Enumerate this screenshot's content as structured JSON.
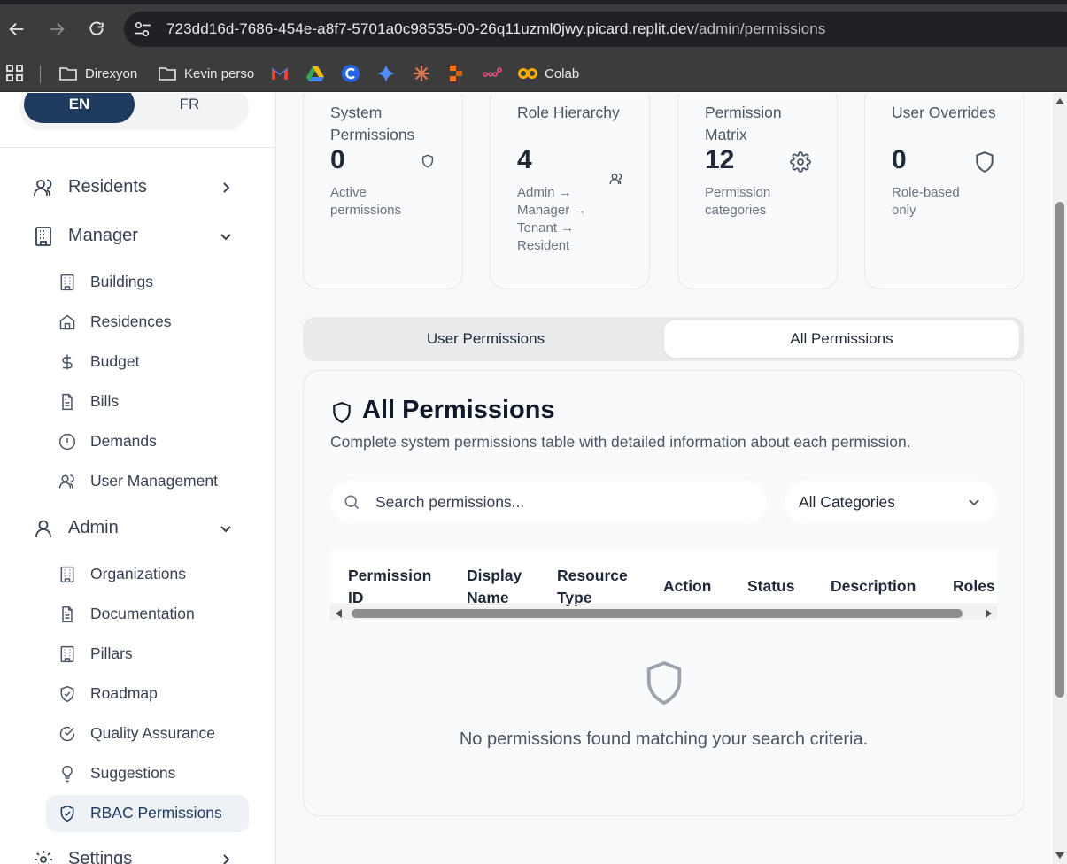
{
  "browser": {
    "url_host": "723dd16d-7686-454e-a8f7-5701a0c98535-00-26q11uzml0jwy.picard.replit.dev",
    "url_path": "/admin/permissions",
    "bookmarks": [
      {
        "label": "Direxyon",
        "icon": "folder-icon"
      },
      {
        "label": "Kevin perso",
        "icon": "folder-icon"
      },
      {
        "label": "",
        "icon": "gmail-icon"
      },
      {
        "label": "",
        "icon": "drive-icon"
      },
      {
        "label": "",
        "icon": "coda-icon"
      },
      {
        "label": "",
        "icon": "gemini-icon"
      },
      {
        "label": "",
        "icon": "claude-icon"
      },
      {
        "label": "",
        "icon": "make-icon"
      },
      {
        "label": "",
        "icon": "n8n-icon"
      },
      {
        "label": "Colab",
        "icon": "colab-icon"
      }
    ]
  },
  "sidebar": {
    "lang": {
      "en": "EN",
      "fr": "FR",
      "selected": "EN"
    },
    "groups": {
      "residents": {
        "label": "Residents",
        "icon": "users-icon",
        "expanded": false
      },
      "manager": {
        "label": "Manager",
        "icon": "building-icon",
        "expanded": true
      },
      "admin": {
        "label": "Admin",
        "icon": "user-icon",
        "expanded": true
      },
      "settings": {
        "label": "Settings",
        "icon": "gear-icon",
        "expanded": false
      }
    },
    "manager_items": [
      {
        "label": "Buildings",
        "icon": "building-icon"
      },
      {
        "label": "Residences",
        "icon": "home-icon"
      },
      {
        "label": "Budget",
        "icon": "dollar-icon"
      },
      {
        "label": "Bills",
        "icon": "file-text-icon"
      },
      {
        "label": "Demands",
        "icon": "alert-circle-icon"
      },
      {
        "label": "User Management",
        "icon": "users-icon"
      }
    ],
    "admin_items": [
      {
        "label": "Organizations",
        "icon": "building-icon"
      },
      {
        "label": "Documentation",
        "icon": "file-text-icon"
      },
      {
        "label": "Pillars",
        "icon": "building-icon"
      },
      {
        "label": "Roadmap",
        "icon": "shield-check-icon"
      },
      {
        "label": "Quality Assurance",
        "icon": "check-circle-icon"
      },
      {
        "label": "Suggestions",
        "icon": "lightbulb-icon"
      },
      {
        "label": "RBAC Permissions",
        "icon": "shield-check-icon",
        "active": true
      }
    ]
  },
  "stats": [
    {
      "title": "System Permissions",
      "value": "0",
      "sub": "Active permissions",
      "icon": "shield-icon"
    },
    {
      "title": "Role Hierarchy",
      "value": "4",
      "sub": "Admin → Manager → Tenant → Resident",
      "icon": "users-icon"
    },
    {
      "title": "Permission Matrix",
      "value": "12",
      "sub": "Permission categories",
      "icon": "gear-icon"
    },
    {
      "title": "User Overrides",
      "value": "0",
      "sub": "Role-based only",
      "icon": "shield-icon"
    }
  ],
  "tabs": {
    "user_permissions": "User Permissions",
    "all_permissions": "All Permissions",
    "selected": "All Permissions"
  },
  "panel": {
    "title": "All Permissions",
    "description": "Complete system permissions table with detailed information about each permission.",
    "search_placeholder": "Search permissions...",
    "category_selected": "All Categories",
    "columns": [
      "Permission ID",
      "Display Name",
      "Resource Type",
      "Action",
      "Status",
      "Description",
      "Roles"
    ],
    "empty_message": "No permissions found matching your search criteria."
  },
  "colors": {
    "accent": "#1f3a5f",
    "active_bg": "#eef1f5"
  }
}
